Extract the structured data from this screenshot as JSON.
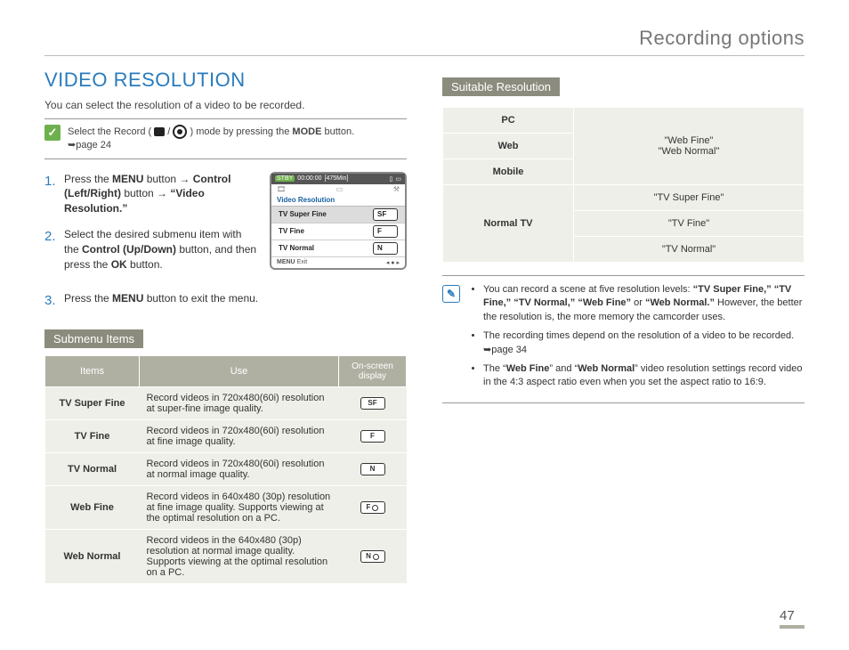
{
  "header": {
    "title": "Recording options"
  },
  "pageNumber": "47",
  "left": {
    "heading": "VIDEO RESOLUTION",
    "intro": "You can select the resolution of a video to be recorded.",
    "modeNote": {
      "line1a": "Select the Record ( ",
      "line1b": " / ",
      "line1c": " ) mode by pressing the ",
      "line1d": " button.",
      "modeWord": "MODE",
      "line2": "➥page 24"
    },
    "steps": [
      {
        "n": "1.",
        "html": "Press the <b>MENU</b> button → <b>Control (Left/Right)</b> button → <b>“Video Resolution.”</b>"
      },
      {
        "n": "2.",
        "html": "Select the desired submenu item with the <b>Control (Up/Down)</b> button, and then press the <b>OK</b> button."
      },
      {
        "n": "3.",
        "html": "Press the <b>MENU</b> button to exit the menu."
      }
    ],
    "lcd": {
      "stby": "STBY",
      "time": "00:00:00",
      "remain": "[475Min]",
      "title": "Video Resolution",
      "items": [
        "TV Super Fine",
        "TV Fine",
        "TV Normal"
      ],
      "menuLabel": "MENU",
      "exitLabel": "Exit"
    },
    "submenuHeader": "Submenu Items",
    "table": {
      "cols": [
        "Items",
        "Use",
        "On-screen display"
      ],
      "rows": [
        {
          "name": "TV Super Fine",
          "use": "Record videos in 720x480(60i) resolution at super-fine image quality.",
          "icon": "SF"
        },
        {
          "name": "TV Fine",
          "use": "Record videos in 720x480(60i) resolution at fine image quality.",
          "icon": "F"
        },
        {
          "name": "TV Normal",
          "use": "Record videos in 720x480(60i) resolution at normal image quality.",
          "icon": "N"
        },
        {
          "name": "Web Fine",
          "use": "Record videos in 640x480 (30p) resolution at fine image quality. Supports viewing at the optimal resolution on a PC.",
          "icon": "F",
          "web": true
        },
        {
          "name": "Web Normal",
          "use": "Record videos in the 640x480 (30p) resolution at normal image quality. Supports viewing at the optimal resolution on a PC.",
          "icon": "N",
          "web": true
        }
      ]
    }
  },
  "right": {
    "suitableHeader": "Suitable Resolution",
    "suitable": {
      "group1": {
        "labels": [
          "PC",
          "Web",
          "Mobile"
        ],
        "value": "\"Web Fine\"\n\"Web Normal\""
      },
      "group2": {
        "label": "Normal TV",
        "values": [
          "\"TV Super Fine\"",
          "\"TV Fine\"",
          "\"TV Normal\""
        ]
      }
    },
    "notes": [
      "You can record a scene at five resolution levels: <b>“TV Super Fine,” “TV Fine,” “TV Normal,” “Web Fine”</b> or <b>“Web Normal.”</b> However, the better the resolution is, the more memory the camcorder uses.",
      "The recording times depend on the resolution of a video to be recorded. ➥page 34",
      "The “<b>Web Fine</b>” and “<b>Web Normal</b>” video resolution settings record video in the 4:3 aspect ratio even when you set the aspect ratio to 16:9."
    ]
  }
}
